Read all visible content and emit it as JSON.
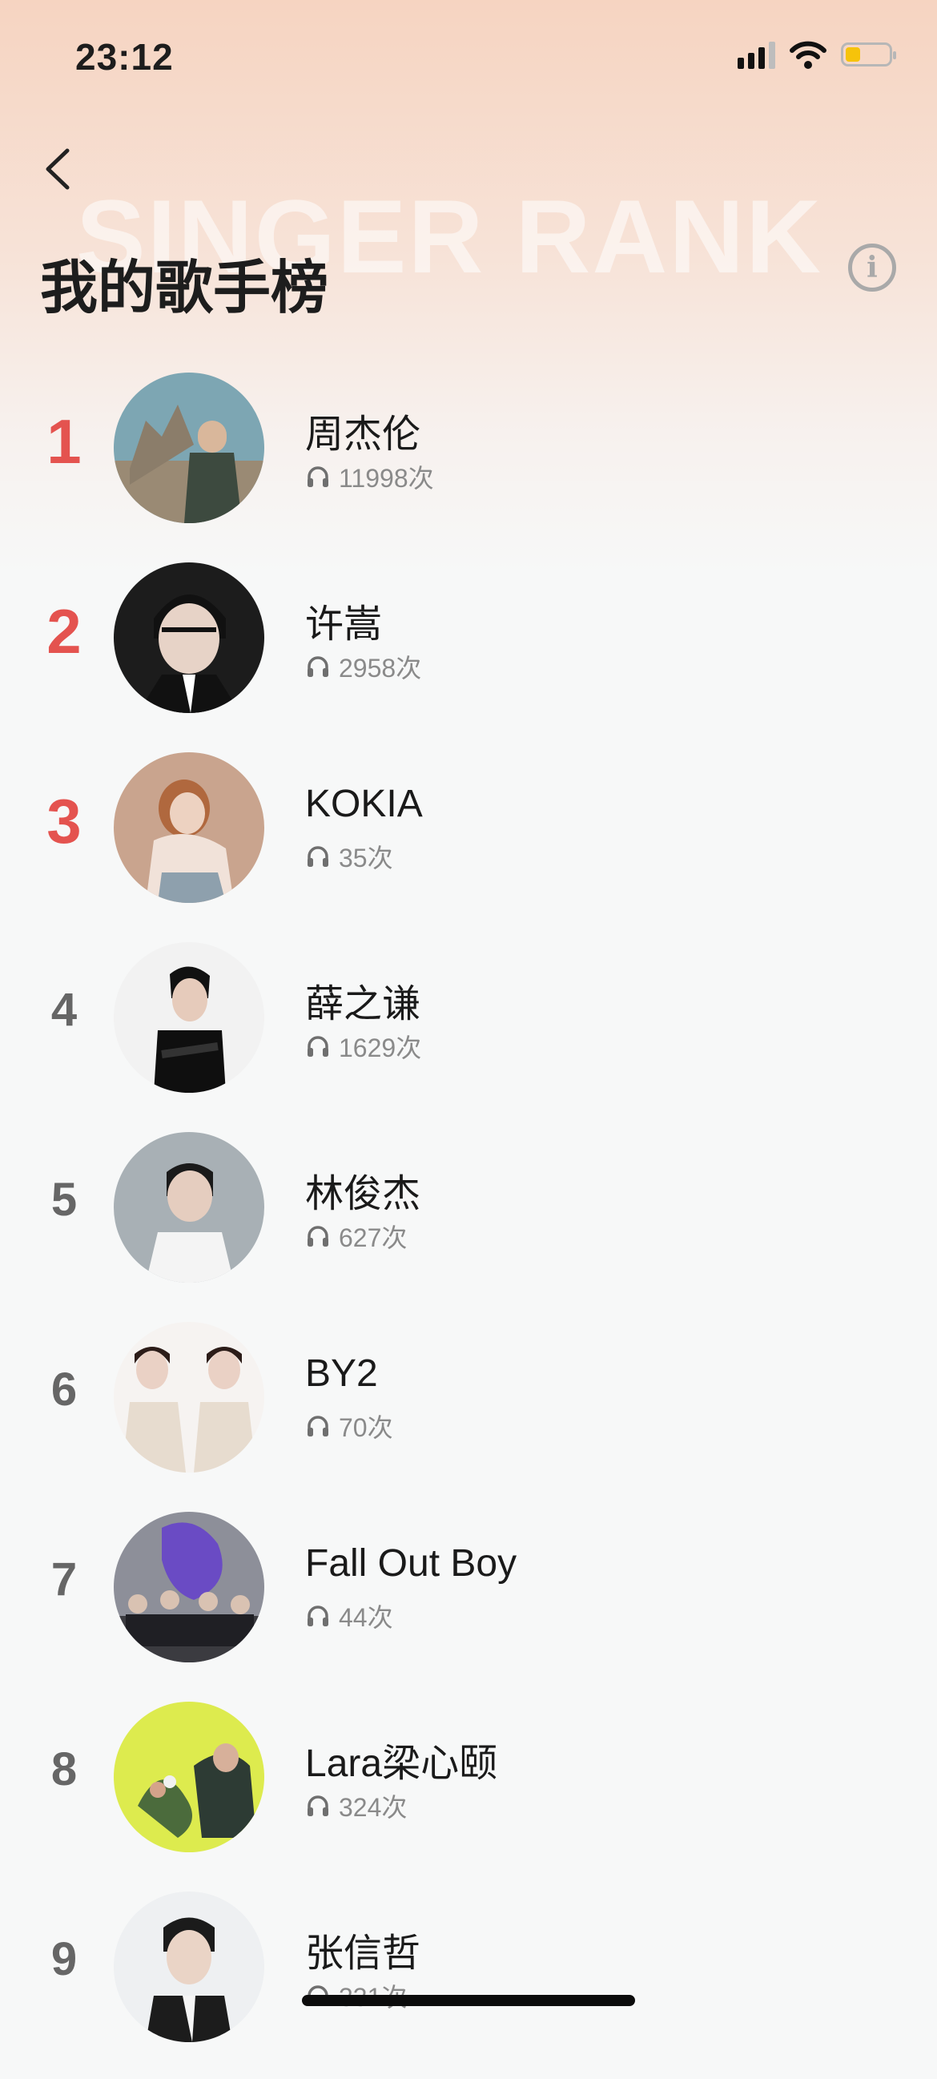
{
  "status_bar": {
    "time": "23:12",
    "battery_level": 0.35,
    "battery_color": "#f6c30a"
  },
  "header": {
    "back_icon": "chevron-left-icon",
    "watermark": "SINGER RANK",
    "title": "我的歌手榜",
    "info_icon": "info-icon"
  },
  "accent_color": "#e4534f",
  "play_icon": "headphones-icon",
  "singers": [
    {
      "rank": "1",
      "name": "周杰伦",
      "count": "11998次"
    },
    {
      "rank": "2",
      "name": "许嵩",
      "count": "2958次"
    },
    {
      "rank": "3",
      "name": "KOKIA",
      "count": "35次"
    },
    {
      "rank": "4",
      "name": "薛之谦",
      "count": "1629次"
    },
    {
      "rank": "5",
      "name": "林俊杰",
      "count": "627次"
    },
    {
      "rank": "6",
      "name": "BY2",
      "count": "70次"
    },
    {
      "rank": "7",
      "name": "Fall Out Boy",
      "count": "44次"
    },
    {
      "rank": "8",
      "name": "Lara梁心颐",
      "count": "324次"
    },
    {
      "rank": "9",
      "name": "张信哲",
      "count": "331次"
    }
  ]
}
